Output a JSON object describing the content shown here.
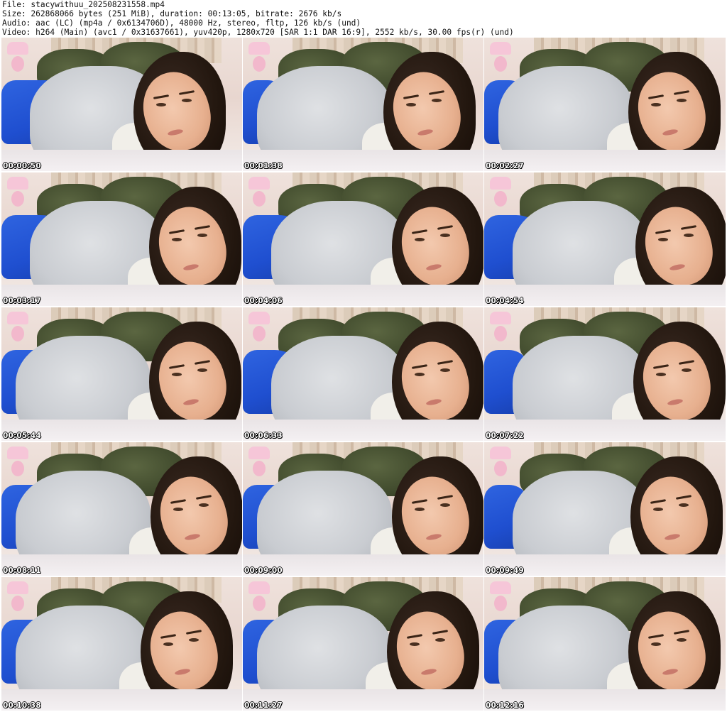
{
  "header": {
    "file_line": "File: stacywithuu_202508231558.mp4",
    "size_line": "Size: 262868066 bytes (251 MiB), duration: 00:13:05, bitrate: 2676 kb/s",
    "audio_line": "Audio: aac (LC) (mp4a / 0x6134706D), 48000 Hz, stereo, fltp, 126 kb/s (und)",
    "video_line": "Video: h264 (Main) (avc1 / 0x31637661), yuv420p, 1280x720 [SAR 1:1 DAR 16:9], 2552 kb/s, 30.00 fps(r) (und)"
  },
  "thumbnails": [
    {
      "timestamp": "00:00:50"
    },
    {
      "timestamp": "00:01:38"
    },
    {
      "timestamp": "00:02:27"
    },
    {
      "timestamp": "00:03:17"
    },
    {
      "timestamp": "00:04:06"
    },
    {
      "timestamp": "00:04:54"
    },
    {
      "timestamp": "00:05:44"
    },
    {
      "timestamp": "00:06:33"
    },
    {
      "timestamp": "00:07:22"
    },
    {
      "timestamp": "00:08:11"
    },
    {
      "timestamp": "00:09:00"
    },
    {
      "timestamp": "00:09:49"
    },
    {
      "timestamp": "00:10:38"
    },
    {
      "timestamp": "00:11:27"
    },
    {
      "timestamp": "00:12:16"
    }
  ],
  "colors": {
    "background": "#ffffff",
    "header_text": "#111111",
    "timestamp_text": "#ffffff",
    "timestamp_outline": "#000000"
  }
}
